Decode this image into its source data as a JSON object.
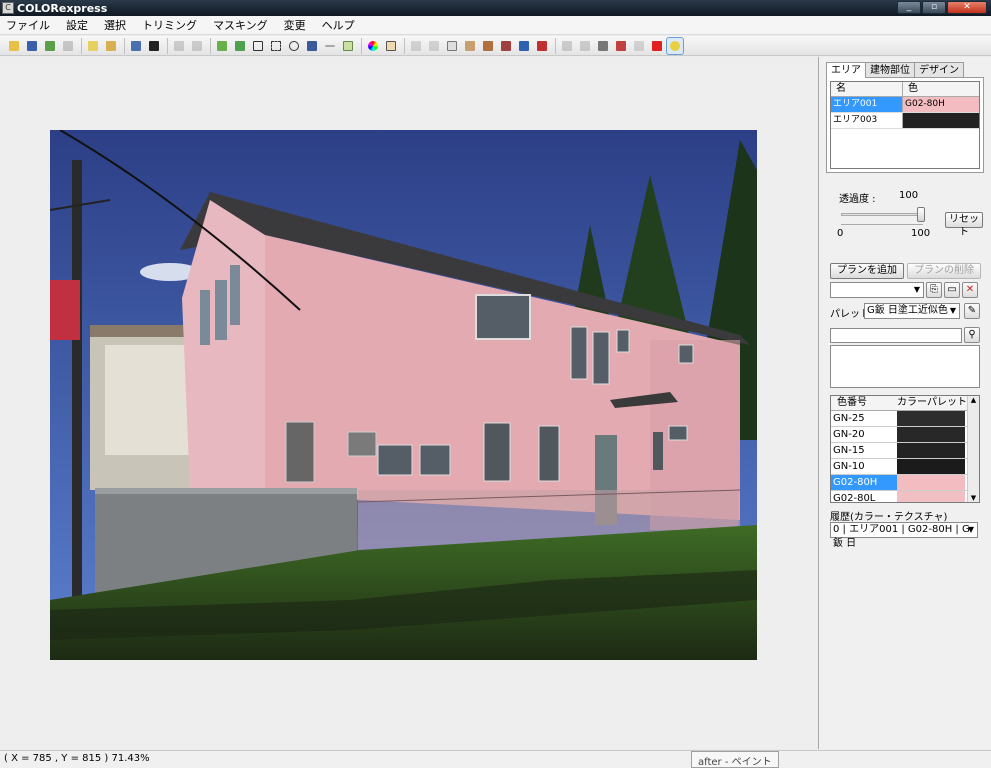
{
  "window": {
    "title": "COLORexpress"
  },
  "menu": [
    "ファイル",
    "設定",
    "選択",
    "トリミング",
    "マスキング",
    "変更",
    "ヘルプ"
  ],
  "status": {
    "coords": "( X = 785 , Y = 815 )  71.43%",
    "mode": "after - ペイント"
  },
  "panel": {
    "tabs": [
      "エリア",
      "建物部位",
      "デザイン"
    ],
    "area_table": {
      "headers": [
        "名",
        "色"
      ],
      "rows": [
        {
          "name": "エリア001",
          "color_label": "G02-80H",
          "color": "#f2bcc0",
          "selected": true
        },
        {
          "name": "エリア003",
          "color_label": "",
          "color": "#222222",
          "selected": false
        }
      ]
    },
    "transparency_label": "透過度 :",
    "transparency_value": "100",
    "slider_min": "0",
    "slider_max": "100",
    "reset_button": "リセット",
    "add_plan_button": "プランを追加",
    "delete_plan_button": "プランの削除",
    "palette_label": "パレット",
    "palette_select": "G鈑  日塗工近似色",
    "palette_table": {
      "headers": [
        "色番号",
        "カラーパレット"
      ],
      "rows": [
        {
          "code": "GN-25",
          "color": "#2d2d2d",
          "selected": false
        },
        {
          "code": "GN-20",
          "color": "#282828",
          "selected": false
        },
        {
          "code": "GN-15",
          "color": "#232323",
          "selected": false
        },
        {
          "code": "GN-10",
          "color": "#1b1b1b",
          "selected": false
        },
        {
          "code": "G02-80H",
          "color": "#f2bcc0",
          "selected": true
        },
        {
          "code": "G02-80L",
          "color": "#f0c0c4",
          "selected": false
        }
      ]
    },
    "history_label": "履歴(カラー・テクスチャ)",
    "history_select": "0 | エリア001 | G02-80H | G鈑 日"
  }
}
